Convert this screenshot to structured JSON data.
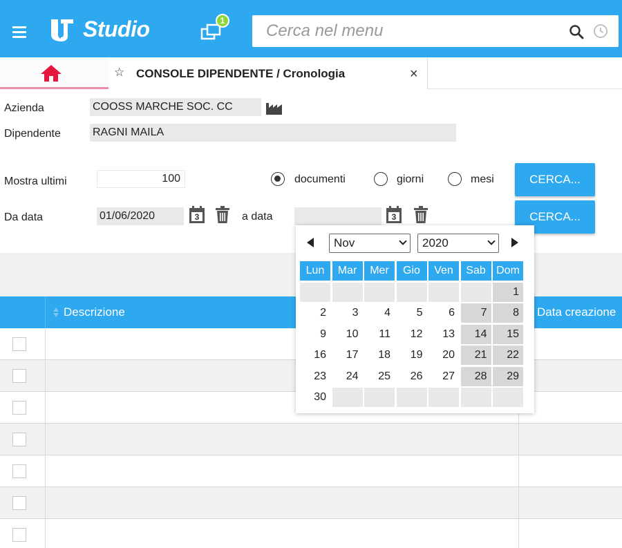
{
  "app": {
    "brand": "Studio",
    "notification_count": "1",
    "search_placeholder": "Cerca nel menu",
    "colors": {
      "primary": "#2ea8ef",
      "badge": "#8fd63a",
      "home_icon": "#e5173f"
    }
  },
  "tabs": {
    "home_icon": "home-icon",
    "active_title": "CONSOLE DIPENDENTE / Cronologia",
    "close": "×",
    "star": "☆"
  },
  "form": {
    "azienda_label": "Azienda",
    "azienda_value": "COOSS MARCHE SOC. CC",
    "dipendente_label": "Dipendente",
    "dipendente_value": "RAGNI MAILA",
    "mostra_label": "Mostra ultimi",
    "mostra_value": "100",
    "radio_documenti": "documenti",
    "radio_giorni": "giorni",
    "radio_mesi": "mesi",
    "selected_radio": "documenti",
    "search_button": "CERCA...",
    "search_button_2": "CERCA...",
    "da_data_label": "Da data",
    "da_data_value": "01/06/2020",
    "a_data_label": "a data",
    "a_data_value": "",
    "calendar_icon_text": "3"
  },
  "grid": {
    "col_description": "Descrizione",
    "col_created": "Data creazione",
    "rows": 7
  },
  "calendar": {
    "month": "Nov",
    "year": "2020",
    "weekdays": [
      "Lun",
      "Mar",
      "Mer",
      "Gio",
      "Ven",
      "Sab",
      "Dom"
    ],
    "weeks": [
      [
        "",
        "",
        "",
        "",
        "",
        "",
        "1"
      ],
      [
        "2",
        "3",
        "4",
        "5",
        "6",
        "7",
        "8"
      ],
      [
        "9",
        "10",
        "11",
        "12",
        "13",
        "14",
        "15"
      ],
      [
        "16",
        "17",
        "18",
        "19",
        "20",
        "21",
        "22"
      ],
      [
        "23",
        "24",
        "25",
        "26",
        "27",
        "28",
        "29"
      ],
      [
        "30",
        "",
        "",
        "",
        "",
        "",
        ""
      ]
    ]
  }
}
